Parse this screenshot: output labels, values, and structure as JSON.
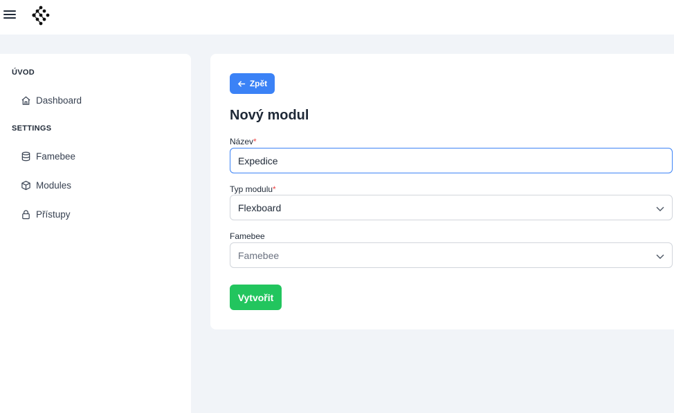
{
  "sidebar": {
    "sections": [
      {
        "title": "ÚVOD",
        "items": [
          {
            "label": "Dashboard",
            "icon": "home-icon"
          }
        ]
      },
      {
        "title": "SETTINGS",
        "items": [
          {
            "label": "Famebee",
            "icon": "database-icon"
          },
          {
            "label": "Modules",
            "icon": "cube-icon"
          },
          {
            "label": "Přístupy",
            "icon": "lock-icon"
          }
        ]
      }
    ]
  },
  "form": {
    "back_label": "Zpět",
    "title": "Nový modul",
    "name_label": "Název",
    "name_value": "Expedice",
    "type_label": "Typ modulu",
    "type_value": "Flexboard",
    "famebee_label": "Famebee",
    "famebee_placeholder": "Famebee",
    "required_mark": "*",
    "submit_label": "Vytvořit"
  },
  "colors": {
    "primary": "#3b82f6",
    "success": "#22c55e",
    "required": "#ef4444",
    "background": "#f1f4f8"
  }
}
